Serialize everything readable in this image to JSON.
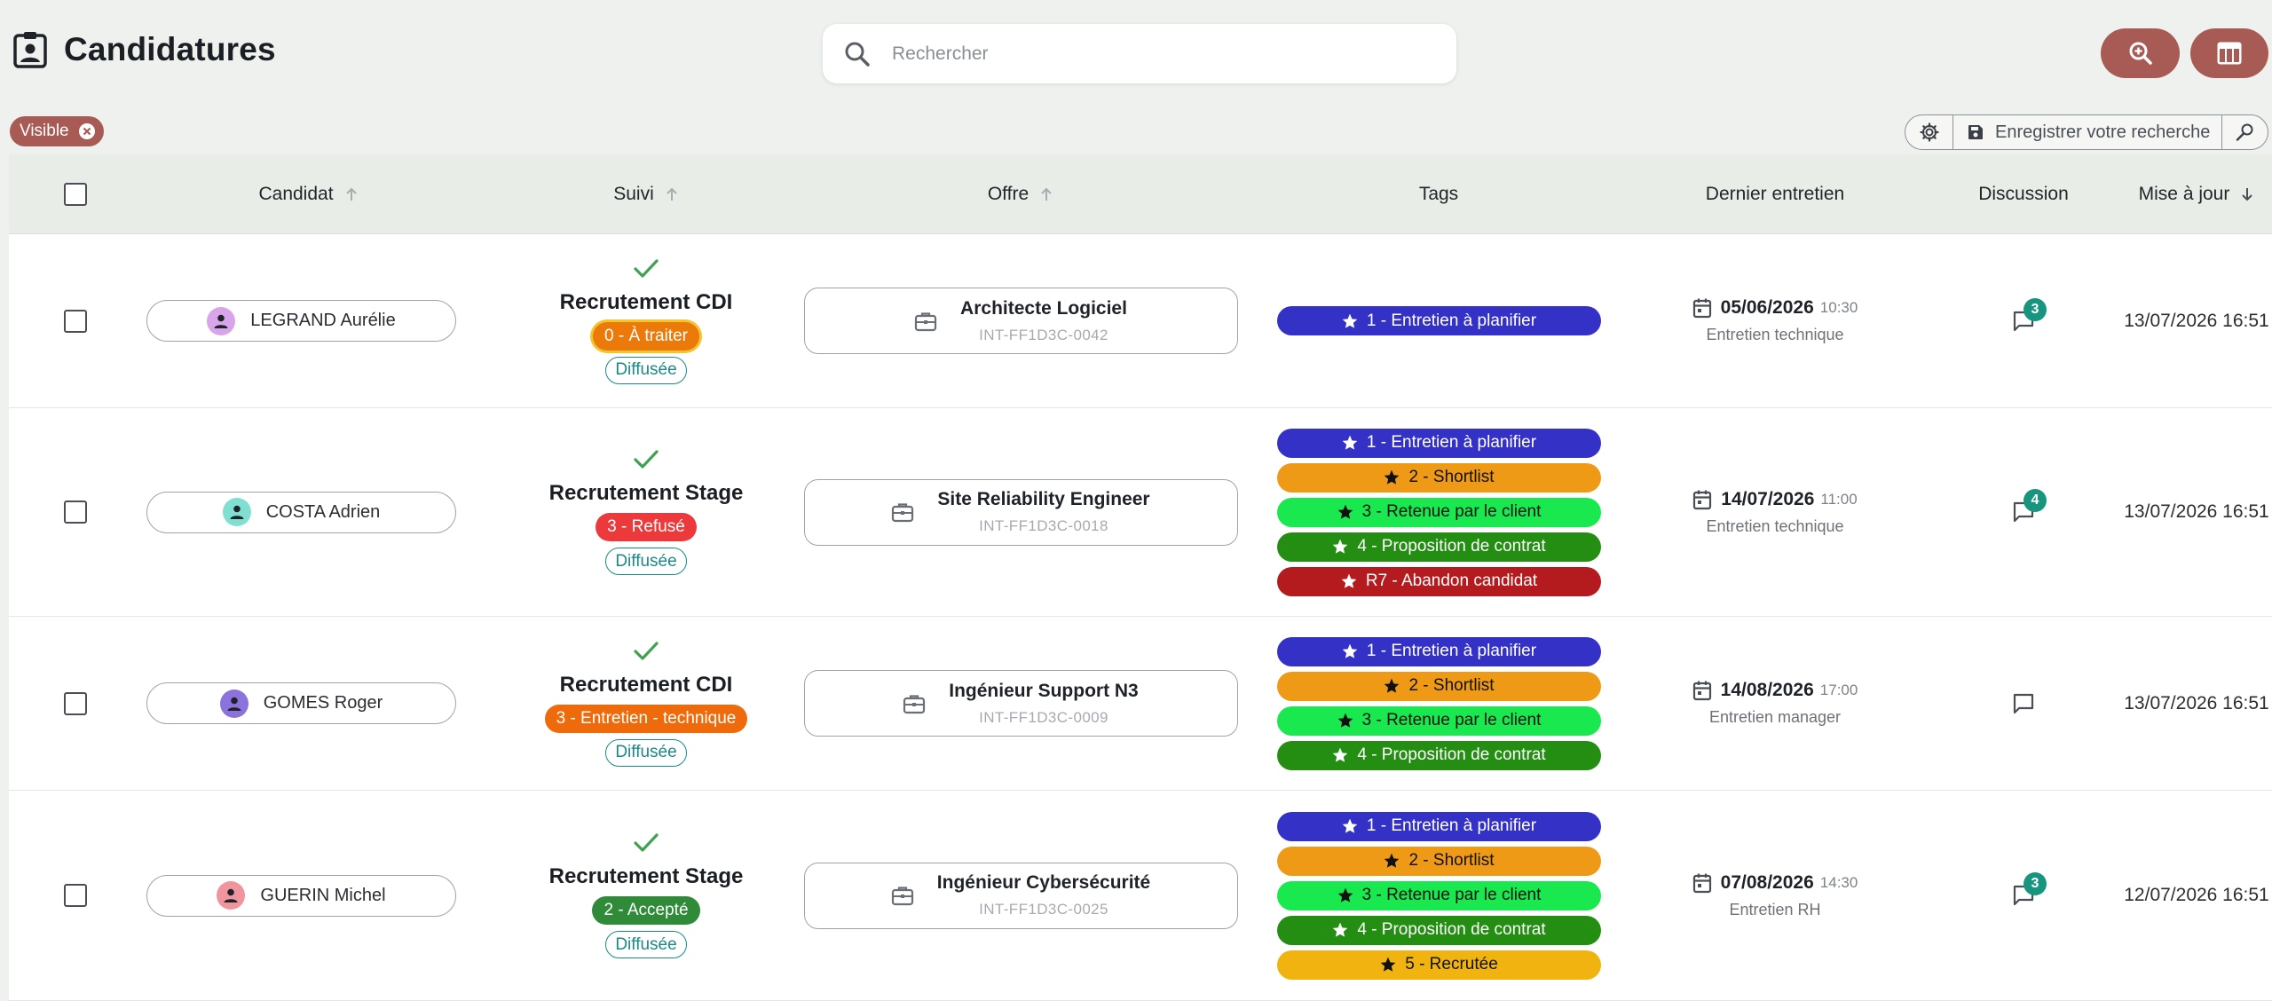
{
  "header": {
    "title": "Candidatures",
    "search_placeholder": "Rechercher"
  },
  "filters": {
    "active_chip": "Visible",
    "save_search_label": "Enregistrer votre recherche"
  },
  "table": {
    "columns": [
      "Candidat",
      "Suivi",
      "Offre",
      "Tags",
      "Dernier entretien",
      "Discussion",
      "Mise à jour"
    ],
    "rows": [
      {
        "candidate": "LEGRAND Aurélie",
        "avatar_color": "#d8a5ea",
        "process": "Recrutement CDI",
        "status": "0 - À traiter",
        "status_color": "#ec7a0a",
        "status_highlight": true,
        "publication": "Diffusée",
        "offer_title": "Architecte Logiciel",
        "offer_ref": "INT-FF1D3C-0042",
        "tags": [
          "1 - Entretien à planifier"
        ],
        "interview_date": "05/06/2026",
        "interview_time": "10:30",
        "interview_type": "Entretien technique",
        "messages": "3",
        "updated": "13/07/2026 16:51"
      },
      {
        "candidate": "COSTA Adrien",
        "avatar_color": "#7fe0d2",
        "process": "Recrutement Stage",
        "status": "3 - Refusé",
        "status_color": "#ec3a3c",
        "status_highlight": false,
        "publication": "Diffusée",
        "offer_title": "Site Reliability Engineer",
        "offer_ref": "INT-FF1D3C-0018",
        "tags": [
          "1 - Entretien à planifier",
          "2 - Shortlist",
          "3 - Retenue par le client",
          "4 - Proposition de contrat",
          "R7 - Abandon candidat"
        ],
        "interview_date": "14/07/2026",
        "interview_time": "11:00",
        "interview_type": "Entretien technique",
        "messages": "4",
        "updated": "13/07/2026 16:51"
      },
      {
        "candidate": "GOMES Roger",
        "avatar_color": "#8b72dc",
        "process": "Recrutement CDI",
        "status": "3 - Entretien - technique",
        "status_color": "#ef6a0a",
        "status_highlight": false,
        "publication": "Diffusée",
        "offer_title": "Ingénieur Support N3",
        "offer_ref": "INT-FF1D3C-0009",
        "tags": [
          "1 - Entretien à planifier",
          "2 - Shortlist",
          "3 - Retenue par le client",
          "4 - Proposition de contrat"
        ],
        "interview_date": "14/08/2026",
        "interview_time": "17:00",
        "interview_type": "Entretien manager",
        "messages": "",
        "updated": "13/07/2026 16:51"
      },
      {
        "candidate": "GUERIN Michel",
        "avatar_color": "#f0959d",
        "process": "Recrutement Stage",
        "status": "2 - Accepté",
        "status_color": "#2f8b38",
        "status_highlight": false,
        "publication": "Diffusée",
        "offer_title": "Ingénieur Cybersécurité",
        "offer_ref": "INT-FF1D3C-0025",
        "tags": [
          "1 - Entretien à planifier",
          "2 - Shortlist",
          "3 - Retenue par le client",
          "4 - Proposition de contrat",
          "5 - Recrutée"
        ],
        "interview_date": "07/08/2026",
        "interview_time": "14:30",
        "interview_type": "Entretien RH",
        "messages": "3",
        "updated": "12/07/2026 16:51"
      }
    ]
  },
  "tag_styles": {
    "1 - Entretien à planifier": {
      "bg": "#3431c6",
      "fg": "#ffffff"
    },
    "2 - Shortlist": {
      "bg": "#ef9a16",
      "fg": "#111111"
    },
    "3 - Retenue par le client": {
      "bg": "#19e94f",
      "fg": "#111111"
    },
    "4 - Proposition de contrat": {
      "bg": "#238e12",
      "fg": "#ffffff"
    },
    "R7 - Abandon candidat": {
      "bg": "#b41b1e",
      "fg": "#ffffff"
    },
    "5 - Recrutée": {
      "bg": "#f0b30f",
      "fg": "#111111"
    }
  },
  "colors": {
    "accent": "#a85b55",
    "header_bg": "#e8eee7",
    "badge": "#18957f",
    "diffusee": "#1a8a85"
  },
  "icons": {
    "title": "contact-badge-icon",
    "search": "search-icon",
    "zoom_button": "zoom-in-icon",
    "layout_button": "table-layout-icon",
    "chip_remove": "close-circle-icon",
    "settings": "gear-icon",
    "save": "floppy-disk-icon",
    "saved_search": "person-search-icon",
    "offer": "briefcase-icon",
    "tag": "star-icon",
    "interview": "calendar-icon",
    "discussion": "chat-bubble-icon",
    "sort_asc": "arrow-up-icon",
    "sort_desc": "arrow-down-icon"
  }
}
